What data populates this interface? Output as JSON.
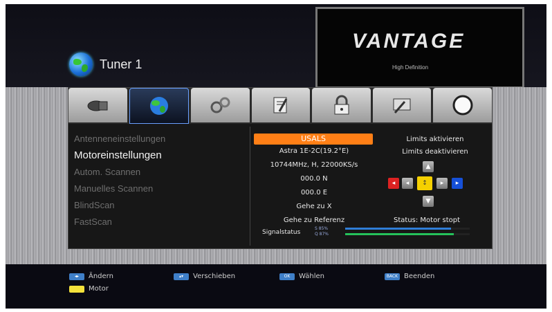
{
  "header": {
    "title": "Tuner 1"
  },
  "preview": {
    "logo_text": "VANTAGE",
    "logo_sub": "High Definition"
  },
  "tabs": [
    {
      "name": "tab-satellite-dish"
    },
    {
      "name": "tab-globe-active"
    },
    {
      "name": "tab-gears"
    },
    {
      "name": "tab-notes"
    },
    {
      "name": "tab-lock"
    },
    {
      "name": "tab-tools"
    },
    {
      "name": "tab-power-circle"
    }
  ],
  "menu": {
    "items": [
      "Antenneneinstellungen",
      "Motoreinstellungen",
      "Autom. Scannen",
      "Manuelles Scannen",
      "BlindScan",
      "FastScan"
    ]
  },
  "center": {
    "mode": "USALS",
    "satellite": "Astra 1E-2C(19.2°E)",
    "transponder": "10744MHz, H, 22000KS/s",
    "longitude": "000.0 N",
    "latitude": "000.0 E",
    "goto_x": "Gehe zu X",
    "goto_ref": "Gehe zu Referenz",
    "signal_label": "Signalstatus",
    "signal_s": "S 85%",
    "signal_q": "Q 87%"
  },
  "right": {
    "limits_on": "Limits aktivieren",
    "limits_off": "Limits deaktivieren",
    "status": "Status:  Motor stopt"
  },
  "signal": {
    "s_percent": 85,
    "q_percent": 87
  },
  "footer": {
    "change": "Ändern",
    "move": "Verschieben",
    "select": "Wählen",
    "exit": "Beenden",
    "motor": "Motor",
    "ok_key": "OK",
    "back_key": "BACK"
  }
}
